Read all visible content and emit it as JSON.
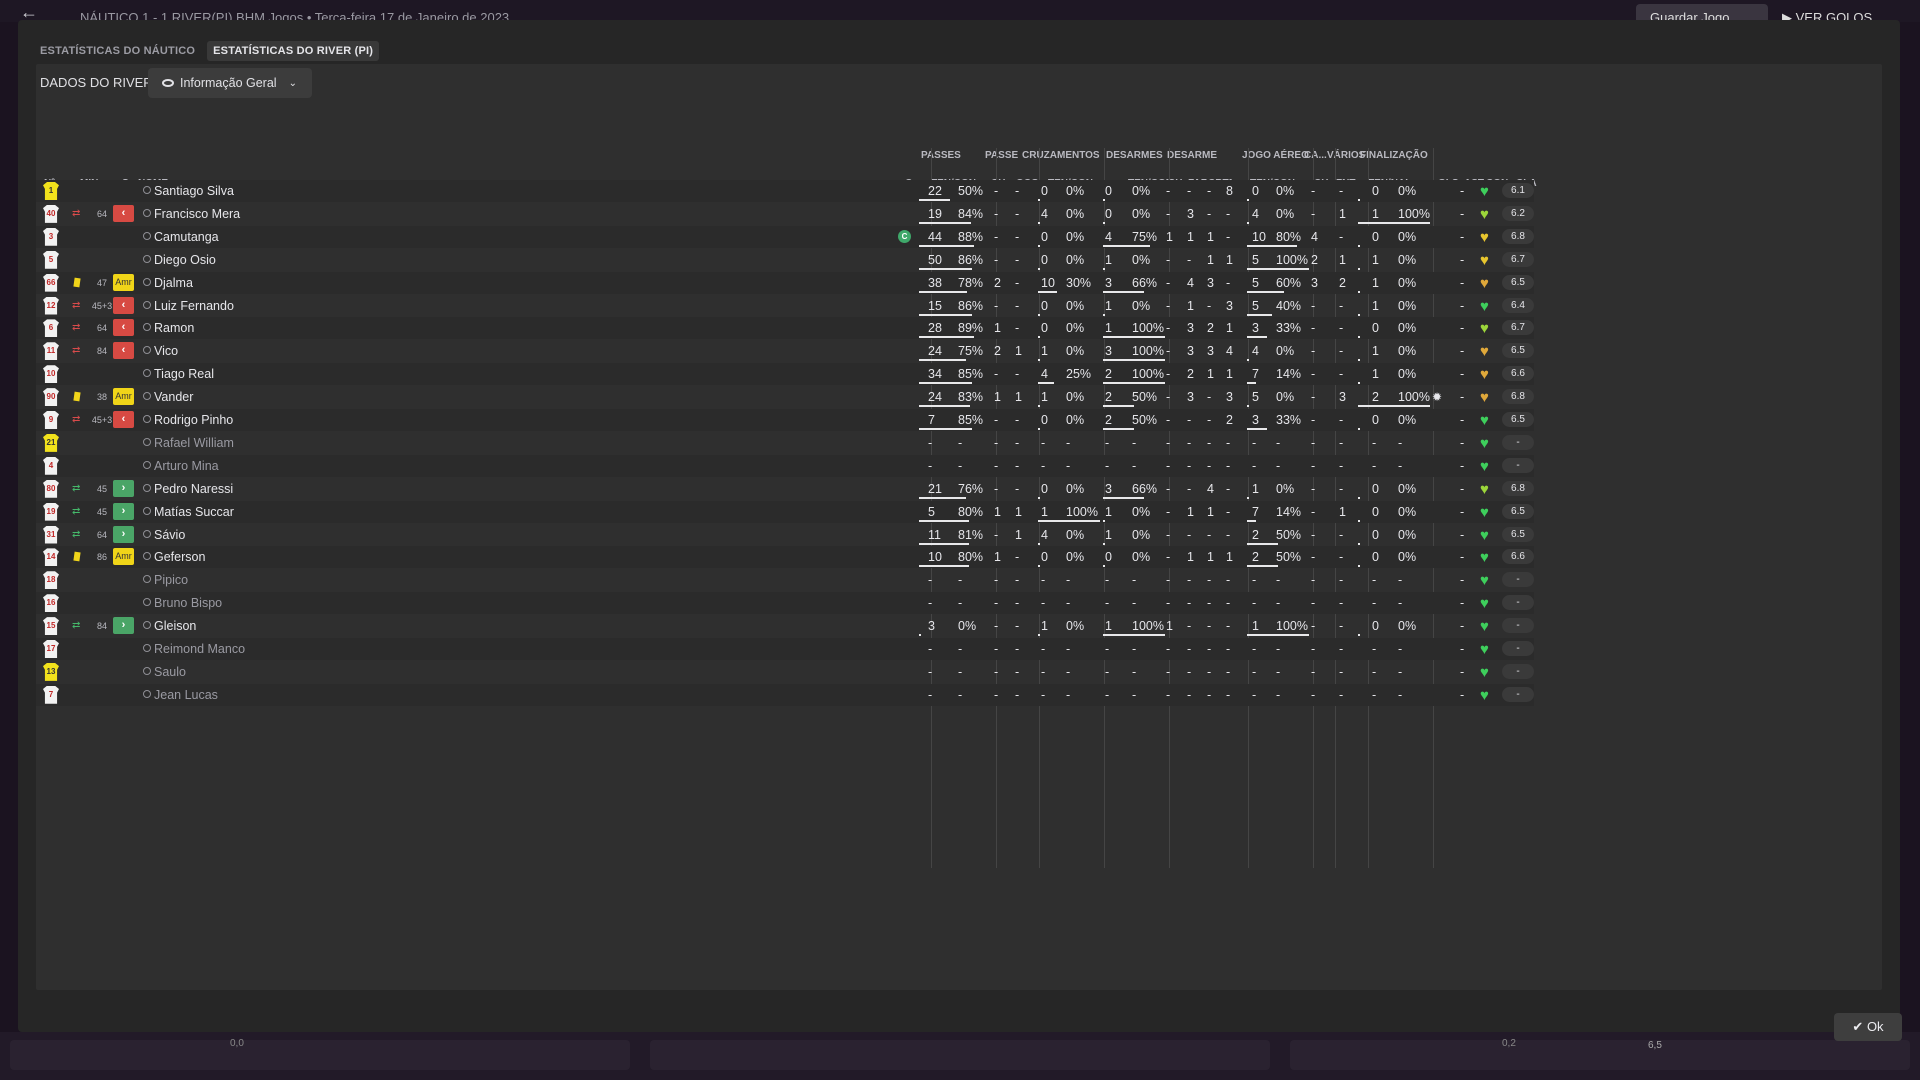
{
  "header": {
    "back_icon": "arrow-left-icon",
    "breadcrumb": "NÁUTICO  1 - 1  RIVER(PI)   BHM Jogos  •  Terça-feira 17 de Janeiro de 2023",
    "save_label": "Guardar Jogo",
    "goals_label": "VER GOLOS"
  },
  "tabs": [
    "ESTATÍSTICAS DO NÁUTICO",
    "ESTATÍSTICAS DO RIVER (PI)"
  ],
  "panel": {
    "title": "DADOS DO RIVER (PI)",
    "view_select": "Informação Geral"
  },
  "columns": {
    "fixed": {
      "num": "Nº",
      "min": "MIN",
      "s": "S",
      "name": "NOME",
      "c": "C"
    },
    "groups": [
      "PASSES",
      "PASSE",
      "CRUZAMENTOS",
      "DESARMES",
      "DESARME",
      "JOGO AÉREO",
      "CA...",
      "VÁRIOS",
      "FINALIZAÇÃO"
    ],
    "sub": [
      "TEN/CON",
      "CH",
      "OCG",
      "TEN/CON",
      "TEN/CON",
      "CH",
      "FAF",
      "CRT",
      "A...",
      "TEN/CON",
      "CH",
      "FNT",
      "TEN/NAL",
      "GLS",
      "AST",
      "CON",
      "CLA"
    ]
  },
  "players": [
    {
      "num": "1",
      "gk": true,
      "name": "Santiago Silva",
      "p": [
        "22",
        "50%"
      ],
      "pch": "-",
      "pocg": "-",
      "cr": [
        "0",
        "0%"
      ],
      "de": [
        "0",
        "0%"
      ],
      "dch": "-",
      "faf": "-",
      "crt": "-",
      "da": "8",
      "ja": [
        "0",
        "0%"
      ],
      "ach": "-",
      "fnt": "-",
      "fi": [
        "0",
        "0%"
      ],
      "gls": "",
      "ast": "-",
      "heart": "green",
      "cla": "6.1"
    },
    {
      "num": "40",
      "sub": "out",
      "min": "64",
      "badge": "out",
      "name": "Francisco Mera",
      "p": [
        "19",
        "84%"
      ],
      "pch": "-",
      "pocg": "-",
      "cr": [
        "4",
        "0%"
      ],
      "de": [
        "0",
        "0%"
      ],
      "dch": "-",
      "faf": "3",
      "crt": "-",
      "da": "-",
      "ja": [
        "4",
        "0%"
      ],
      "ach": "-",
      "fnt": "1",
      "fi": [
        "1",
        "100%"
      ],
      "gls": "",
      "ast": "-",
      "heart": "green-yellow",
      "cla": "6.2"
    },
    {
      "num": "3",
      "name": "Camutanga",
      "c": true,
      "p": [
        "44",
        "88%"
      ],
      "pch": "-",
      "pocg": "-",
      "cr": [
        "0",
        "0%"
      ],
      "de": [
        "4",
        "75%"
      ],
      "dch": "1",
      "faf": "1",
      "crt": "1",
      "da": "-",
      "ja": [
        "10",
        "80%"
      ],
      "ach": "4",
      "fnt": "-",
      "fi": [
        "0",
        "0%"
      ],
      "gls": "",
      "ast": "-",
      "heart": "yellow",
      "cla": "6.8"
    },
    {
      "num": "5",
      "name": "Diego Osio",
      "p": [
        "50",
        "86%"
      ],
      "pch": "-",
      "pocg": "-",
      "cr": [
        "0",
        "0%"
      ],
      "de": [
        "1",
        "0%"
      ],
      "dch": "-",
      "faf": "-",
      "crt": "1",
      "da": "1",
      "ja": [
        "5",
        "100%"
      ],
      "ach": "2",
      "fnt": "1",
      "fi": [
        "1",
        "0%"
      ],
      "gls": "",
      "ast": "-",
      "heart": "yellow",
      "cla": "6.7"
    },
    {
      "num": "66",
      "card": true,
      "min": "47",
      "badge": "amr",
      "name": "Djalma",
      "p": [
        "38",
        "78%"
      ],
      "pch": "2",
      "pocg": "-",
      "cr": [
        "10",
        "30%"
      ],
      "de": [
        "3",
        "66%"
      ],
      "dch": "-",
      "faf": "4",
      "crt": "3",
      "da": "-",
      "ja": [
        "5",
        "60%"
      ],
      "ach": "3",
      "fnt": "2",
      "fi": [
        "1",
        "0%"
      ],
      "gls": "",
      "ast": "-",
      "heart": "orange",
      "cla": "6.5"
    },
    {
      "num": "12",
      "sub": "out",
      "min": "45+3",
      "badge": "out",
      "name": "Luiz Fernando",
      "p": [
        "15",
        "86%"
      ],
      "pch": "-",
      "pocg": "-",
      "cr": [
        "0",
        "0%"
      ],
      "de": [
        "1",
        "0%"
      ],
      "dch": "-",
      "faf": "1",
      "crt": "-",
      "da": "3",
      "ja": [
        "5",
        "40%"
      ],
      "ach": "-",
      "fnt": "-",
      "fi": [
        "1",
        "0%"
      ],
      "gls": "",
      "ast": "-",
      "heart": "green",
      "cla": "6.4"
    },
    {
      "num": "6",
      "sub": "out",
      "min": "64",
      "badge": "out",
      "name": "Ramon",
      "p": [
        "28",
        "89%"
      ],
      "pch": "1",
      "pocg": "-",
      "cr": [
        "0",
        "0%"
      ],
      "de": [
        "1",
        "100%"
      ],
      "dch": "-",
      "faf": "3",
      "crt": "2",
      "da": "1",
      "ja": [
        "3",
        "33%"
      ],
      "ach": "-",
      "fnt": "-",
      "fi": [
        "0",
        "0%"
      ],
      "gls": "",
      "ast": "-",
      "heart": "green-yellow",
      "cla": "6.7"
    },
    {
      "num": "11",
      "sub": "out",
      "min": "84",
      "badge": "out",
      "name": "Vico",
      "p": [
        "24",
        "75%"
      ],
      "pch": "2",
      "pocg": "1",
      "cr": [
        "1",
        "0%"
      ],
      "de": [
        "3",
        "100%"
      ],
      "dch": "-",
      "faf": "3",
      "crt": "3",
      "da": "4",
      "ja": [
        "4",
        "0%"
      ],
      "ach": "-",
      "fnt": "-",
      "fi": [
        "1",
        "0%"
      ],
      "gls": "",
      "ast": "-",
      "heart": "orange",
      "cla": "6.5"
    },
    {
      "num": "10",
      "name": "Tiago Real",
      "p": [
        "34",
        "85%"
      ],
      "pch": "-",
      "pocg": "-",
      "cr": [
        "4",
        "25%"
      ],
      "de": [
        "2",
        "100%"
      ],
      "dch": "-",
      "faf": "2",
      "crt": "1",
      "da": "1",
      "ja": [
        "7",
        "14%"
      ],
      "ach": "-",
      "fnt": "-",
      "fi": [
        "1",
        "0%"
      ],
      "gls": "",
      "ast": "-",
      "heart": "orange",
      "cla": "6.6"
    },
    {
      "num": "90",
      "card": true,
      "min": "38",
      "badge": "amr",
      "name": "Vander",
      "p": [
        "24",
        "83%"
      ],
      "pch": "1",
      "pocg": "1",
      "cr": [
        "1",
        "0%"
      ],
      "de": [
        "2",
        "50%"
      ],
      "dch": "-",
      "faf": "3",
      "crt": "-",
      "da": "3",
      "ja": [
        "5",
        "0%"
      ],
      "ach": "-",
      "fnt": "3",
      "fi": [
        "2",
        "100%"
      ],
      "gls": "gear",
      "ast": "-",
      "heart": "orange",
      "cla": "6.8"
    },
    {
      "num": "9",
      "sub": "out",
      "min": "45+3",
      "badge": "out",
      "name": "Rodrigo Pinho",
      "p": [
        "7",
        "85%"
      ],
      "pch": "-",
      "pocg": "-",
      "cr": [
        "0",
        "0%"
      ],
      "de": [
        "2",
        "50%"
      ],
      "dch": "-",
      "faf": "-",
      "crt": "-",
      "da": "2",
      "ja": [
        "3",
        "33%"
      ],
      "ach": "-",
      "fnt": "-",
      "fi": [
        "0",
        "0%"
      ],
      "gls": "",
      "ast": "-",
      "heart": "green",
      "cla": "6.5"
    },
    {
      "num": "21",
      "gk": true,
      "dim": true,
      "name": "Rafael William",
      "p": [
        "-",
        "-"
      ],
      "pch": "-",
      "pocg": "-",
      "cr": [
        "-",
        "-"
      ],
      "de": [
        "-",
        "-"
      ],
      "dch": "-",
      "faf": "-",
      "crt": "-",
      "da": "-",
      "ja": [
        "-",
        "-"
      ],
      "ach": "-",
      "fnt": "-",
      "fi": [
        "-",
        "-"
      ],
      "gls": "",
      "ast": "-",
      "heart": "green",
      "cla": "-"
    },
    {
      "num": "4",
      "dim": true,
      "name": "Arturo Mina",
      "p": [
        "-",
        "-"
      ],
      "pch": "-",
      "pocg": "-",
      "cr": [
        "-",
        "-"
      ],
      "de": [
        "-",
        "-"
      ],
      "dch": "-",
      "faf": "-",
      "crt": "-",
      "da": "-",
      "ja": [
        "-",
        "-"
      ],
      "ach": "-",
      "fnt": "-",
      "fi": [
        "-",
        "-"
      ],
      "gls": "",
      "ast": "-",
      "heart": "green",
      "cla": "-"
    },
    {
      "num": "80",
      "sub": "in",
      "min": "45",
      "badge": "in",
      "name": "Pedro Naressi",
      "p": [
        "21",
        "76%"
      ],
      "pch": "-",
      "pocg": "-",
      "cr": [
        "0",
        "0%"
      ],
      "de": [
        "3",
        "66%"
      ],
      "dch": "-",
      "faf": "-",
      "crt": "4",
      "da": "-",
      "ja": [
        "1",
        "0%"
      ],
      "ach": "-",
      "fnt": "-",
      "fi": [
        "0",
        "0%"
      ],
      "gls": "",
      "ast": "-",
      "heart": "green-yellow",
      "cla": "6.8"
    },
    {
      "num": "19",
      "sub": "in",
      "min": "45",
      "badge": "in",
      "name": "Matías Succar",
      "p": [
        "5",
        "80%"
      ],
      "pch": "1",
      "pocg": "1",
      "cr": [
        "1",
        "100%"
      ],
      "de": [
        "1",
        "0%"
      ],
      "dch": "-",
      "faf": "1",
      "crt": "1",
      "da": "-",
      "ja": [
        "7",
        "14%"
      ],
      "ach": "-",
      "fnt": "1",
      "fi": [
        "0",
        "0%"
      ],
      "gls": "",
      "ast": "-",
      "heart": "green",
      "cla": "6.5"
    },
    {
      "num": "31",
      "sub": "in",
      "min": "64",
      "badge": "in",
      "name": "Sávio",
      "p": [
        "11",
        "81%"
      ],
      "pch": "-",
      "pocg": "1",
      "cr": [
        "4",
        "0%"
      ],
      "de": [
        "1",
        "0%"
      ],
      "dch": "-",
      "faf": "-",
      "crt": "-",
      "da": "-",
      "ja": [
        "2",
        "50%"
      ],
      "ach": "-",
      "fnt": "-",
      "fi": [
        "0",
        "0%"
      ],
      "gls": "",
      "ast": "-",
      "heart": "green",
      "cla": "6.5"
    },
    {
      "num": "14",
      "card": true,
      "min": "86",
      "badge": "amr",
      "name": "Geferson",
      "p": [
        "10",
        "80%"
      ],
      "pch": "1",
      "pocg": "-",
      "cr": [
        "0",
        "0%"
      ],
      "de": [
        "0",
        "0%"
      ],
      "dch": "-",
      "faf": "1",
      "crt": "1",
      "da": "1",
      "ja": [
        "2",
        "50%"
      ],
      "ach": "-",
      "fnt": "-",
      "fi": [
        "0",
        "0%"
      ],
      "gls": "",
      "ast": "-",
      "heart": "green",
      "cla": "6.6"
    },
    {
      "num": "18",
      "dim": true,
      "name": "Pipico",
      "p": [
        "-",
        "-"
      ],
      "pch": "-",
      "pocg": "-",
      "cr": [
        "-",
        "-"
      ],
      "de": [
        "-",
        "-"
      ],
      "dch": "-",
      "faf": "-",
      "crt": "-",
      "da": "-",
      "ja": [
        "-",
        "-"
      ],
      "ach": "-",
      "fnt": "-",
      "fi": [
        "-",
        "-"
      ],
      "gls": "",
      "ast": "-",
      "heart": "green",
      "cla": "-"
    },
    {
      "num": "16",
      "dim": true,
      "name": "Bruno Bispo",
      "p": [
        "-",
        "-"
      ],
      "pch": "-",
      "pocg": "-",
      "cr": [
        "-",
        "-"
      ],
      "de": [
        "-",
        "-"
      ],
      "dch": "-",
      "faf": "-",
      "crt": "-",
      "da": "-",
      "ja": [
        "-",
        "-"
      ],
      "ach": "-",
      "fnt": "-",
      "fi": [
        "-",
        "-"
      ],
      "gls": "",
      "ast": "-",
      "heart": "green",
      "cla": "-"
    },
    {
      "num": "15",
      "sub": "in",
      "min": "84",
      "badge": "in",
      "name": "Gleison",
      "p": [
        "3",
        "0%"
      ],
      "pch": "-",
      "pocg": "-",
      "cr": [
        "1",
        "0%"
      ],
      "de": [
        "1",
        "100%"
      ],
      "dch": "1",
      "faf": "-",
      "crt": "-",
      "da": "-",
      "ja": [
        "1",
        "100%"
      ],
      "ach": "-",
      "fnt": "-",
      "fi": [
        "0",
        "0%"
      ],
      "gls": "",
      "ast": "-",
      "heart": "green",
      "cla": "-"
    },
    {
      "num": "17",
      "dim": true,
      "name": "Reimond Manco",
      "p": [
        "-",
        "-"
      ],
      "pch": "-",
      "pocg": "-",
      "cr": [
        "-",
        "-"
      ],
      "de": [
        "-",
        "-"
      ],
      "dch": "-",
      "faf": "-",
      "crt": "-",
      "da": "-",
      "ja": [
        "-",
        "-"
      ],
      "ach": "-",
      "fnt": "-",
      "fi": [
        "-",
        "-"
      ],
      "gls": "",
      "ast": "-",
      "heart": "green",
      "cla": "-"
    },
    {
      "num": "13",
      "gk": true,
      "dim": true,
      "name": "Saulo",
      "p": [
        "-",
        "-"
      ],
      "pch": "-",
      "pocg": "-",
      "cr": [
        "-",
        "-"
      ],
      "de": [
        "-",
        "-"
      ],
      "dch": "-",
      "faf": "-",
      "crt": "-",
      "da": "-",
      "ja": [
        "-",
        "-"
      ],
      "ach": "-",
      "fnt": "-",
      "fi": [
        "-",
        "-"
      ],
      "gls": "",
      "ast": "-",
      "heart": "green",
      "cla": "-"
    },
    {
      "num": "7",
      "dim": true,
      "name": "Jean Lucas",
      "p": [
        "-",
        "-"
      ],
      "pch": "-",
      "pocg": "-",
      "cr": [
        "-",
        "-"
      ],
      "de": [
        "-",
        "-"
      ],
      "dch": "-",
      "faf": "-",
      "crt": "-",
      "da": "-",
      "ja": [
        "-",
        "-"
      ],
      "ach": "-",
      "fnt": "-",
      "fi": [
        "-",
        "-"
      ],
      "gls": "",
      "ast": "-",
      "heart": "green",
      "cla": "-"
    }
  ],
  "badge_labels": {
    "amr": "Amr"
  },
  "colors": {
    "green": "#3ecf5c",
    "green-yellow": "#9cd63a",
    "yellow": "#e8c62e",
    "orange": "#e0a83a",
    "red_badge": "#d74a43",
    "green_badge": "#4aa567",
    "yellow_card": "#f1d51a"
  },
  "ok_label": "Ok",
  "bottom": {
    "left_value": "0,0",
    "right_value": "6,5",
    "mid_value": "0,2"
  }
}
